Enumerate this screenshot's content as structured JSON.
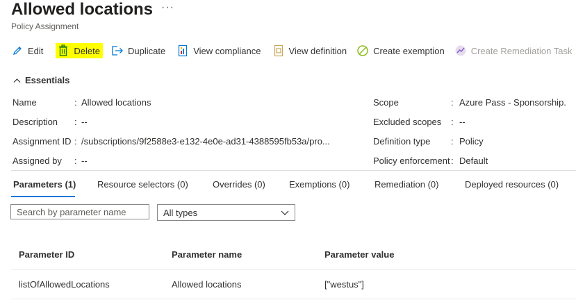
{
  "header": {
    "title": "Allowed locations",
    "more": "···",
    "subtitle": "Policy Assignment"
  },
  "toolbar": {
    "edit": "Edit",
    "delete": "Delete",
    "duplicate": "Duplicate",
    "view_compliance": "View compliance",
    "view_definition": "View definition",
    "create_exemption": "Create exemption",
    "create_remediation": "Create Remediation Task",
    "highlight_color": "#ffff00"
  },
  "essentials": {
    "label": "Essentials",
    "left": [
      {
        "key": "Name",
        "value": "Allowed locations"
      },
      {
        "key": "Description",
        "value": "--"
      },
      {
        "key": "Assignment ID",
        "value": "/subscriptions/9f2588e3-e132-4e0e-ad31-4388595fb53a/pro..."
      },
      {
        "key": "Assigned by",
        "value": "--"
      }
    ],
    "right": [
      {
        "key": "Scope",
        "value": "Azure Pass - Sponsorship."
      },
      {
        "key": "Excluded scopes",
        "value": "--"
      },
      {
        "key": "Definition type",
        "value": "Policy"
      },
      {
        "key": "Policy enforcement",
        "value": "Default"
      }
    ],
    "separator": ":"
  },
  "tabs": [
    {
      "label": "Parameters (1)",
      "active": true
    },
    {
      "label": "Resource selectors (0)"
    },
    {
      "label": "Overrides (0)"
    },
    {
      "label": "Exemptions (0)"
    },
    {
      "label": "Remediation (0)"
    },
    {
      "label": "Deployed resources (0)"
    }
  ],
  "filters": {
    "search_placeholder": "Search by parameter name",
    "type_selected": "All types"
  },
  "table": {
    "headers": [
      "Parameter ID",
      "Parameter name",
      "Parameter value"
    ],
    "rows": [
      [
        "listOfAllowedLocations",
        "Allowed locations",
        "[\"westus\"]"
      ]
    ]
  },
  "colors": {
    "accent": "#0078d4"
  }
}
